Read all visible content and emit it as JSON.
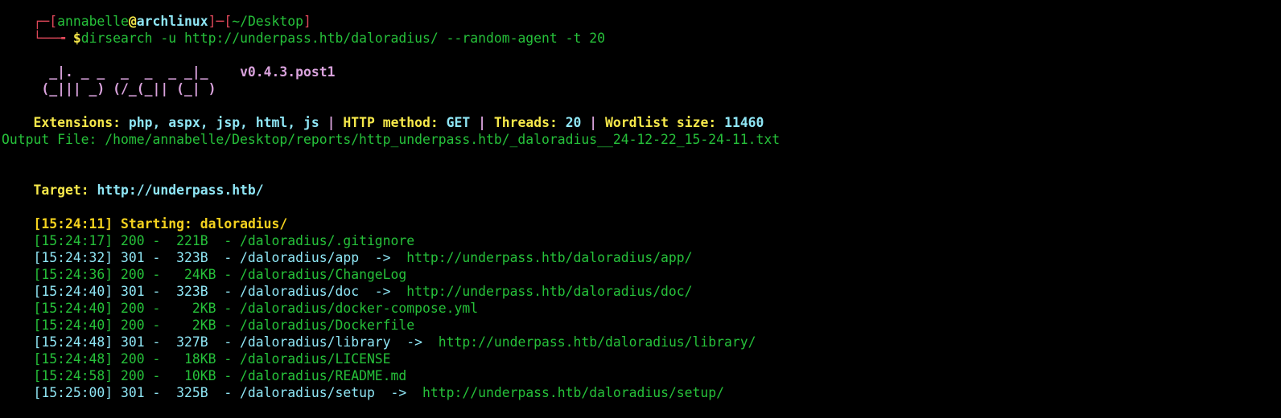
{
  "prompt": {
    "line1": {
      "corner": "┌─[",
      "user": "annabelle",
      "at": "@",
      "host": "archlinux",
      "sep": "]─[",
      "path": "~/Desktop",
      "close": "]"
    },
    "line2": {
      "corner": "└──╼ ",
      "dollar": "$",
      "command": "dirsearch -u http://underpass.htb/daloradius/ --random-agent -t 20"
    }
  },
  "banner": {
    "art_line1": "  _|. _ _  _  _  _ _|_    ",
    "art_line2": " (_||| _) (/_(_|| (_| )",
    "version": "v0.4.3.post1"
  },
  "config": {
    "ext_label": "Extensions: ",
    "ext_value": "php, aspx, jsp, html, js",
    "sep1": " | ",
    "method_label": "HTTP method: ",
    "method_value": "GET",
    "sep2": " | ",
    "threads_label": "Threads: ",
    "threads_value": "20",
    "sep3": " | ",
    "wordlist_label": "Wordlist size: ",
    "wordlist_value": "11460"
  },
  "output_file": "Output File: /home/annabelle/Desktop/reports/http_underpass.htb/_daloradius__24-12-22_15-24-11.txt",
  "target": {
    "label": "Target: ",
    "value": "http://underpass.htb/"
  },
  "starting": {
    "time": "[15:24:11]",
    "label": " Starting: ",
    "value": "daloradius/"
  },
  "results": [
    {
      "text": "[15:24:17] 200 -  221B  - /daloradius/.gitignore",
      "redirect": "",
      "status": "200",
      "color": "#26c13a"
    },
    {
      "text": "[15:24:32] 301 -  323B  - /daloradius/app  ->  ",
      "redirect": "http://underpass.htb/daloradius/app/",
      "status": "301",
      "color": "#8fe6f5"
    },
    {
      "text": "[15:24:36] 200 -   24KB - /daloradius/ChangeLog",
      "redirect": "",
      "status": "200",
      "color": "#26c13a"
    },
    {
      "text": "[15:24:40] 301 -  323B  - /daloradius/doc  ->  ",
      "redirect": "http://underpass.htb/daloradius/doc/",
      "status": "301",
      "color": "#8fe6f5"
    },
    {
      "text": "[15:24:40] 200 -    2KB - /daloradius/docker-compose.yml",
      "redirect": "",
      "status": "200",
      "color": "#26c13a"
    },
    {
      "text": "[15:24:40] 200 -    2KB - /daloradius/Dockerfile",
      "redirect": "",
      "status": "200",
      "color": "#26c13a"
    },
    {
      "text": "[15:24:48] 301 -  327B  - /daloradius/library  ->  ",
      "redirect": "http://underpass.htb/daloradius/library/",
      "status": "301",
      "color": "#8fe6f5"
    },
    {
      "text": "[15:24:48] 200 -   18KB - /daloradius/LICENSE",
      "redirect": "",
      "status": "200",
      "color": "#26c13a"
    },
    {
      "text": "[15:24:58] 200 -   10KB - /daloradius/README.md",
      "redirect": "",
      "status": "200",
      "color": "#26c13a"
    },
    {
      "text": "[15:25:00] 301 -  325B  - /daloradius/setup  ->  ",
      "redirect": "http://underpass.htb/daloradius/setup/",
      "status": "301",
      "color": "#8fe6f5"
    }
  ],
  "colors": {
    "background": "#000000",
    "ok_green": "#26c13a",
    "redirect_cyan": "#8fe6f5",
    "label_yellow": "#f6e84a",
    "banner_pink": "#d9a2dc",
    "prompt_red": "#e0485a"
  }
}
